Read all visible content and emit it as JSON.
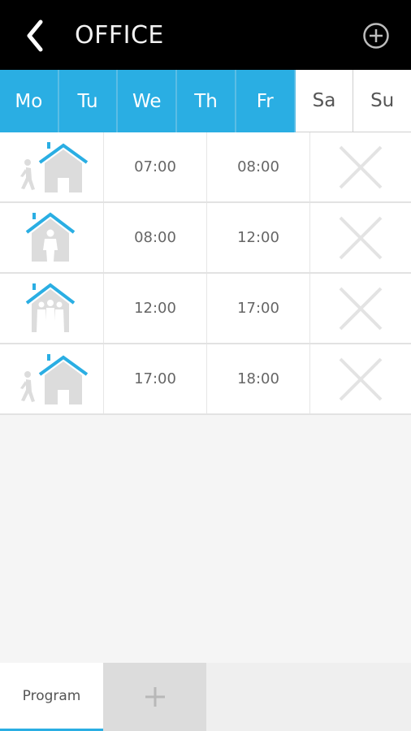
{
  "header": {
    "title": "OFFICE",
    "back_icon": "chevron-left-icon",
    "add_icon": "circle-plus-icon"
  },
  "days": [
    {
      "label": "Mo",
      "active": true
    },
    {
      "label": "Tu",
      "active": true
    },
    {
      "label": "We",
      "active": true
    },
    {
      "label": "Th",
      "active": true
    },
    {
      "label": "Fr",
      "active": true
    },
    {
      "label": "Sa",
      "active": false
    },
    {
      "label": "Su",
      "active": false
    }
  ],
  "program": [
    {
      "mode": "arriving-home-icon",
      "start": "07:00",
      "end": "08:00"
    },
    {
      "mode": "person-at-home-icon",
      "start": "08:00",
      "end": "12:00"
    },
    {
      "mode": "family-at-home-icon",
      "start": "12:00",
      "end": "17:00"
    },
    {
      "mode": "arriving-home-icon",
      "start": "17:00",
      "end": "18:00"
    }
  ],
  "footer": {
    "program_tab_label": "Program",
    "add_tab_icon": "plus-icon"
  },
  "colors": {
    "accent": "#2aaee3",
    "header_bg": "#000000",
    "icon_grey": "#dcdcdc"
  }
}
